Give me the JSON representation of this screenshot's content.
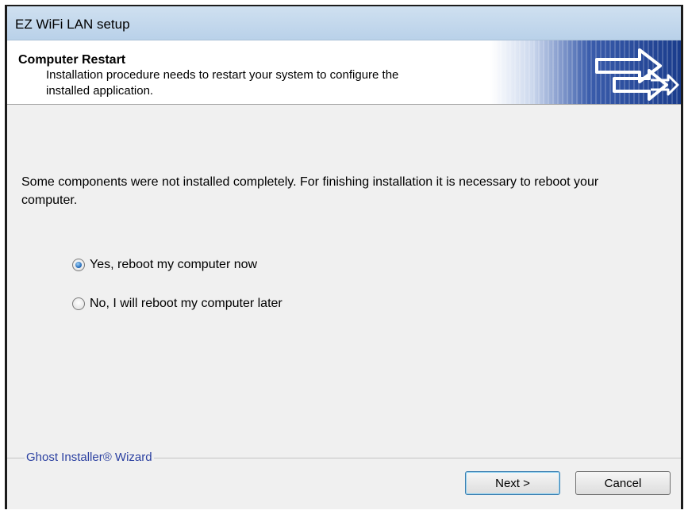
{
  "window": {
    "title": "EZ WiFi LAN setup"
  },
  "header": {
    "title": "Computer Restart",
    "subtitle": "Installation procedure needs to restart your system to configure the installed application."
  },
  "message": "Some components were not installed completely. For finishing installation it is necessary to reboot your computer.",
  "options": [
    {
      "label": "Yes, reboot my computer now",
      "selected": true
    },
    {
      "label": "No, I will reboot my computer later",
      "selected": false
    }
  ],
  "footer": {
    "group_label": "Ghost Installer® Wizard",
    "next_label": "Next >",
    "cancel_label": "Cancel"
  },
  "colors": {
    "titlebar": "#c4d9ee",
    "banner_dark": "#1a3c8c",
    "group_label": "#2a3fa0"
  },
  "icons": [
    "double-arrow-banner-icon",
    "radio-selected-icon",
    "radio-unselected-icon"
  ]
}
